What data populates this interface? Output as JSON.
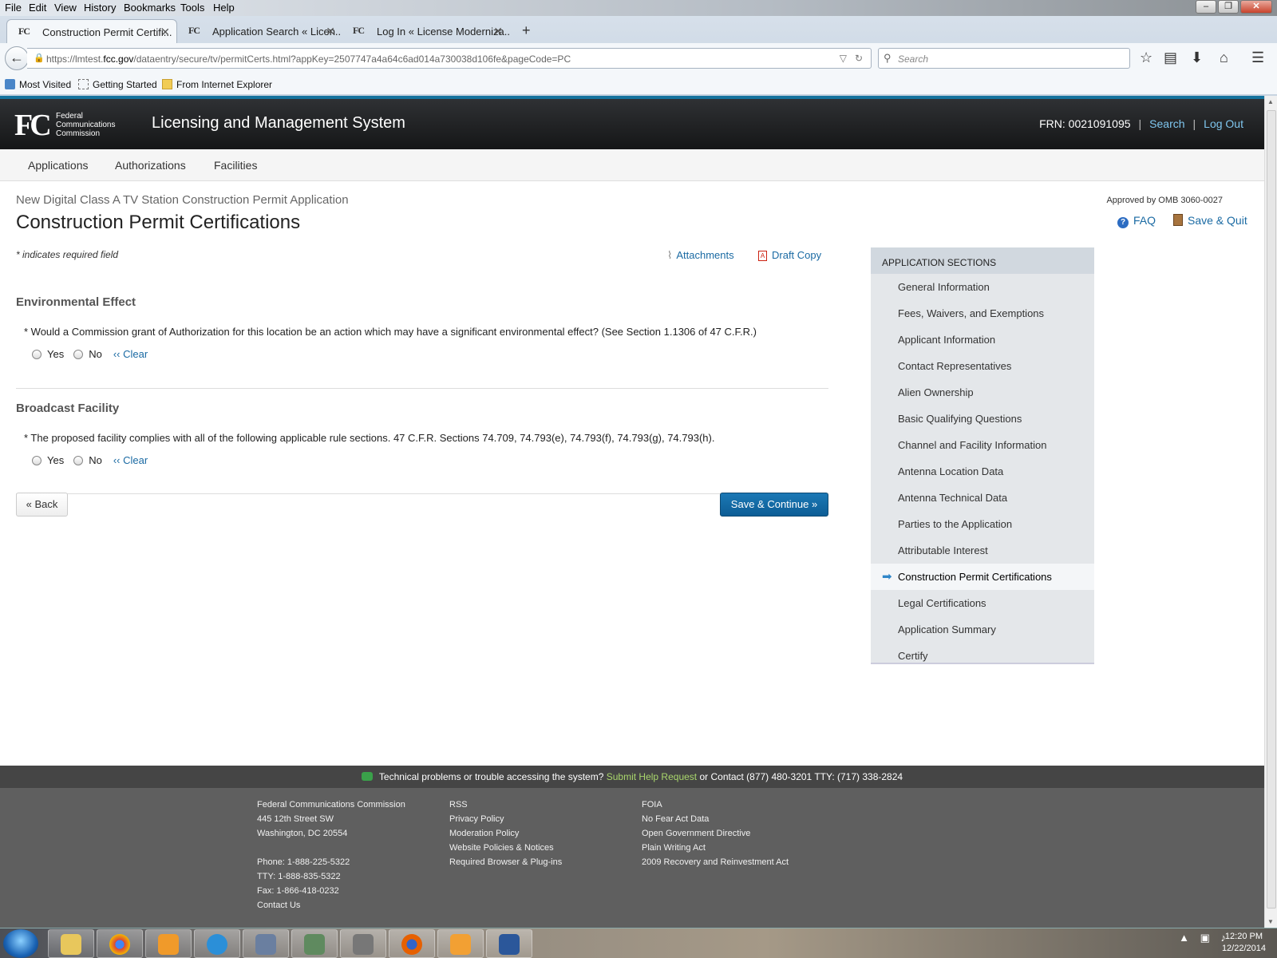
{
  "menu": [
    "File",
    "Edit",
    "View",
    "History",
    "Bookmarks",
    "Tools",
    "Help"
  ],
  "tabs": [
    {
      "icon": "FC",
      "title": "Construction Permit Certifi..."
    },
    {
      "icon": "FC",
      "title": "Application Search « Licen..."
    },
    {
      "icon": "FC",
      "title": "Log In « License Moderniza..."
    }
  ],
  "url": {
    "prefix": "https://lmtest.",
    "domain": "fcc.gov",
    "path": "/dataentry/secure/tv/permitCerts.html?appKey=2507747a4a64c6ad014a730038d106fe&pageCode=PC"
  },
  "search_placeholder": "Search",
  "bookmarks": [
    "Most Visited",
    "Getting Started",
    "From Internet Explorer"
  ],
  "site": {
    "logo_mark": "FC",
    "logo_text": [
      "Federal",
      "Communications",
      "Commission"
    ],
    "title": "Licensing and Management System",
    "frn": "FRN: 0021091095",
    "search_link": "Search",
    "logout_link": "Log Out",
    "nav": [
      "Applications",
      "Authorizations",
      "Facilities"
    ]
  },
  "page": {
    "subtitle": "New Digital Class A TV Station Construction Permit Application",
    "title": "Construction Permit Certifications",
    "omb": "Approved by OMB 3060-0027",
    "faq": "FAQ",
    "save_quit": "Save & Quit",
    "required_note": "* indicates required field",
    "attachments": "Attachments",
    "draft_copy": "Draft Copy"
  },
  "sections": [
    {
      "heading": "Environmental Effect",
      "question": "* Would a Commission grant of Authorization for this location be an action which may have a significant environmental effect? (See Section 1.1306 of 47 C.F.R.)",
      "yes": "Yes",
      "no": "No",
      "clear": "‹‹ Clear"
    },
    {
      "heading": "Broadcast Facility",
      "question": "* The proposed facility complies with all of the following applicable rule sections. 47 C.F.R. Sections 74.709, 74.793(e), 74.793(f), 74.793(g), 74.793(h).",
      "yes": "Yes",
      "no": "No",
      "clear": "‹‹ Clear"
    }
  ],
  "buttons": {
    "back": "« Back",
    "save_continue": "Save & Continue »"
  },
  "app_sections": {
    "heading": "APPLICATION SECTIONS",
    "items": [
      "General Information",
      "Fees, Waivers, and Exemptions",
      "Applicant Information",
      "Contact Representatives",
      "Alien Ownership",
      "Basic Qualifying Questions",
      "Channel and Facility Information",
      "Antenna Location Data",
      "Antenna Technical Data",
      "Parties to the Application",
      "Attributable Interest",
      "Construction Permit Certifications",
      "Legal Certifications",
      "Application Summary",
      "Certify"
    ],
    "active_index": 11
  },
  "footer": {
    "help_prefix": "Technical problems or trouble accessing the system?",
    "help_link": "Submit Help Request",
    "help_suffix": "or Contact (877) 480-3201 TTY: (717) 338-2824",
    "col1": [
      "Federal Communications Commission",
      "445 12th Street SW",
      "Washington, DC 20554",
      "",
      "Phone: 1-888-225-5322",
      "TTY: 1-888-835-5322",
      "Fax: 1-866-418-0232",
      "Contact Us"
    ],
    "col2": [
      "RSS",
      "Privacy Policy",
      "Moderation Policy",
      "Website Policies & Notices",
      "Required Browser & Plug-ins"
    ],
    "col3": [
      "FOIA",
      "No Fear Act Data",
      "Open Government Directive",
      "Plain Writing Act",
      "2009 Recovery and Reinvestment Act"
    ]
  },
  "clock": {
    "time": "12:20 PM",
    "date": "12/22/2014"
  },
  "colors": {
    "header_bg": "#1f2022",
    "accent": "#15739e",
    "link": "#1a6aa3",
    "primary_button": "#0d5d95"
  }
}
